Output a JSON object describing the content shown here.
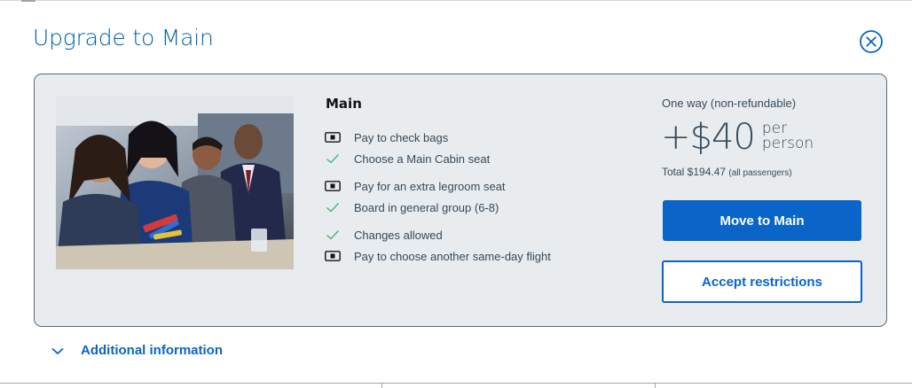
{
  "modal": {
    "title": "Upgrade to Main",
    "close_icon": "close-circle-icon"
  },
  "offer": {
    "cabin_name": "Main",
    "features": [
      {
        "icon": "card-icon",
        "label": "Pay to check bags"
      },
      {
        "icon": "checkmark-icon",
        "label": "Choose a Main Cabin seat"
      },
      {
        "icon": "card-icon",
        "label": "Pay for an extra legroom seat"
      },
      {
        "icon": "checkmark-icon",
        "label": "Board in general group (6-8)"
      },
      {
        "icon": "checkmark-icon",
        "label": "Changes allowed"
      },
      {
        "icon": "card-icon",
        "label": "Pay to choose another same-day flight"
      }
    ]
  },
  "pricing": {
    "caption": "One way (non-refundable)",
    "amount": "+$40",
    "unit_line1": "per",
    "unit_line2": "person",
    "total_label": "Total $194.47",
    "total_note": "(all passengers)"
  },
  "buttons": {
    "primary": "Move to Main",
    "secondary": "Accept restrictions"
  },
  "footer": {
    "additional_info": "Additional information"
  },
  "colors": {
    "brand_blue": "#0b64c8",
    "title_blue": "#0061ab",
    "card_bg": "#e8ecee",
    "check_green": "#3cb371"
  }
}
